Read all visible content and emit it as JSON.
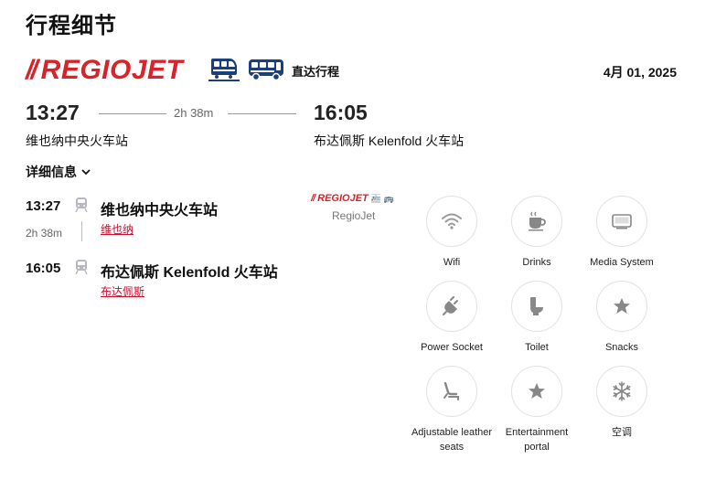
{
  "page": {
    "title": "行程细节"
  },
  "header": {
    "brand": {
      "bars": "//",
      "text": "REGIOJET"
    },
    "icons": [
      "train-icon",
      "bus-icon"
    ],
    "trip_type": "直达行程",
    "date": "4月 01, 2025"
  },
  "summary": {
    "departure_time": "13:27",
    "arrival_time": "16:05",
    "duration": "2h 38m",
    "departure_station": "维也纳中央火车站",
    "arrival_station": "布达佩斯 Kelenfold 火车站"
  },
  "details": {
    "toggle_label": "详细信息",
    "segment_duration": "2h 38m",
    "stops": [
      {
        "time": "13:27",
        "icon": "train-icon",
        "name": "维也纳中央火车站",
        "city": "维也纳"
      },
      {
        "time": "16:05",
        "icon": "train-icon",
        "name": "布达佩斯 Kelenfold 火车站",
        "city": "布达佩斯"
      }
    ]
  },
  "operator": {
    "logo_bars": "//",
    "logo_text": "REGIOJET",
    "logo_icons": "🚈 🚌",
    "name": "RegioJet"
  },
  "amenities": [
    {
      "label": "Wifi",
      "icon": "wifi-icon"
    },
    {
      "label": "Drinks",
      "icon": "coffee-cup-icon"
    },
    {
      "label": "Media System",
      "icon": "monitor-icon"
    },
    {
      "label": "Power Socket",
      "icon": "power-plug-icon"
    },
    {
      "label": "Toilet",
      "icon": "toilet-icon"
    },
    {
      "label": "Snacks",
      "icon": "star-icon"
    },
    {
      "label": "Adjustable leather seats",
      "icon": "seat-icon"
    },
    {
      "label": "Entertainment portal",
      "icon": "star-icon"
    },
    {
      "label": "空调",
      "icon": "snowflake-icon"
    }
  ],
  "colors": {
    "brand_red": "#d8232a",
    "brand_blue": "#1a3f7a",
    "link_red": "#c8102e",
    "icon_gray": "#888888"
  }
}
